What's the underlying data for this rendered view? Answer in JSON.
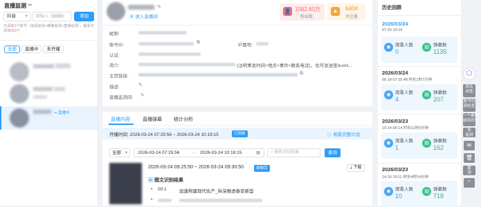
{
  "left": {
    "title": "直播监测",
    "platform": "抖音",
    "search_placeholder": "请输入",
    "add_label": "添加",
    "hint_prefix": "已添加",
    "hint_count1": "1",
    "hint_mid": "个账号（来源监测+精确监测+直播监测），最多可添加",
    "hint_count2": "202",
    "hint_suffix": "个",
    "filters": [
      "全部",
      "直播中",
      "未开播"
    ],
    "live_badge": "直播中"
  },
  "profile": {
    "enter_live": "进入直播间",
    "fans_value": "1582.60万",
    "fans_label": "粉丝数",
    "follow_value": "6404",
    "follow_label": "关注量",
    "labels": {
      "account": "昵称:",
      "id": "账号ID:",
      "auth": "认证:",
      "intro": "简介:",
      "homepage": "主页链接:",
      "desc": "描述:",
      "room": "直播监测间:",
      "ip": "IP属地:"
    },
    "intro_text": "(注明事发时间+地点+事件+联系电话)，也可发送至dushi..."
  },
  "live": {
    "tabs": [
      "直播内容",
      "直播弹幕",
      "统计分析"
    ],
    "open_time_label": "开播时间: 2026-03-24 07:25:56 ~ 2026-03-24 10:19:15",
    "status_tag": "已回放",
    "full_replay": "观看完整片段",
    "filter_select": "全部",
    "date_start": "2026-03-24 07:25:56",
    "date_end": "2026-03-24 10:19:15",
    "search_placeholder": "搜索识别结果",
    "query_label": "查询",
    "segment_time": "2026-03-24 09:25:50 ~ 2026-03-24 09:30:50",
    "segment_tag": "录制完",
    "download_label": "下载",
    "ocr_title": "图文识别结果",
    "ocr_time": "00:1",
    "ocr_text": "加速构建现代化产_纵深推进泰安新型"
  },
  "history": {
    "title": "历史回顾",
    "records": [
      {
        "date": "2026/03/24",
        "time": "07:25-10:19",
        "viewers": "0",
        "danmu": "1135"
      },
      {
        "date": "2026/03/24",
        "time": "06:18-07:25:48",
        "duration": "时长1时7分钟",
        "viewers": "4",
        "danmu": "207"
      },
      {
        "date": "2026/03/23",
        "time": "19:14-06:14",
        "duration": "时长11时0分钟",
        "viewers": "1",
        "danmu": "162"
      },
      {
        "date": "2026/03/23",
        "time": "14:16-19:11",
        "duration": "时长4时54分钟",
        "viewers": "10",
        "danmu": "718"
      }
    ],
    "viewers_label": "观看人数",
    "danmu_label": "弹幕数"
  },
  "tools": [
    "现名\n自查",
    "账号归\n源检查",
    "一个案件\n收到讯号",
    "免\n监测",
    "置\n顶"
  ]
}
